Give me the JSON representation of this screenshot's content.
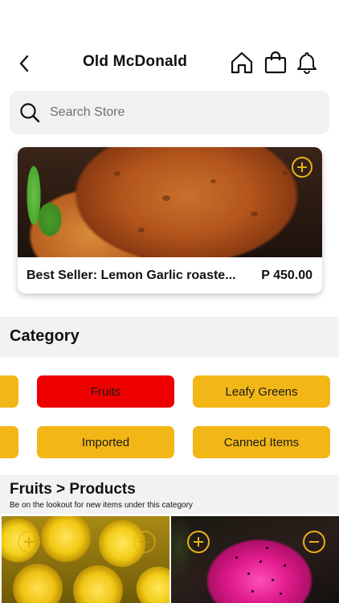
{
  "header": {
    "title": "Old McDonald",
    "icons": [
      "back-chevron-icon",
      "home-icon",
      "shopping-bag-icon",
      "bell-icon"
    ]
  },
  "search": {
    "placeholder": "Search Store",
    "value": ""
  },
  "featured": {
    "name": "Best Seller: Lemon Garlic roaste...",
    "price": "P 450.00"
  },
  "category": {
    "title": "Category",
    "chips": [
      {
        "label": "Fruits",
        "active": true
      },
      {
        "label": "Leafy Greens",
        "active": false
      },
      {
        "label": "Imported",
        "active": false
      },
      {
        "label": "Canned Items",
        "active": false
      }
    ]
  },
  "products": {
    "title": "Fruits > Products",
    "subtitle": "Be on the lookout for new items under this category"
  },
  "colors": {
    "accent": "#f2b616",
    "active_chip": "#ee0000",
    "icon_outline": "#e7b21b",
    "section_bg": "#f2f2f2"
  }
}
